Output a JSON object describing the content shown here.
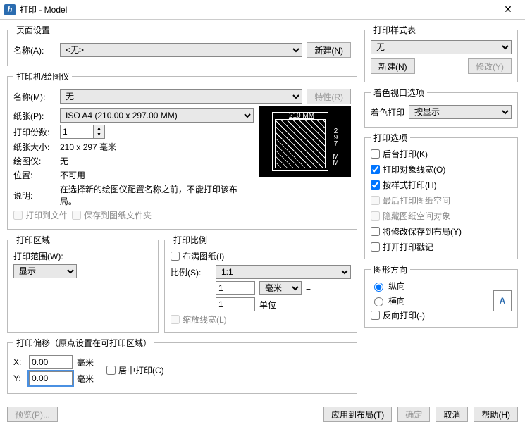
{
  "window": {
    "title": "打印 - Model",
    "app_icon": "h"
  },
  "page_setup": {
    "legend": "页面设置",
    "name_label": "名称(A):",
    "name_value": "<无>",
    "new_btn": "新建(N)"
  },
  "printer": {
    "legend": "打印机/绘图仪",
    "name_label": "名称(M):",
    "name_value": "无",
    "props_btn": "特性(R)",
    "paper_label": "纸张(P):",
    "paper_value": "ISO A4 (210.00 x 297.00 MM)",
    "copies_label": "打印份数:",
    "copies_value": "1",
    "size_label": "纸张大小:",
    "size_value": "210 x 297  毫米",
    "plotter_label": "绘图仪:",
    "plotter_value": "无",
    "location_label": "位置:",
    "location_value": "不可用",
    "desc_label": "说明:",
    "desc_value": "在选择新的绘图仪配置名称之前，不能打印该布局。",
    "to_file": "打印到文件",
    "save_sheet": "保存到图纸文件夹",
    "preview_w": "210 MM",
    "preview_h": "297 MM"
  },
  "area": {
    "legend": "打印区域",
    "range_label": "打印范围(W):",
    "range_value": "显示"
  },
  "scale": {
    "legend": "打印比例",
    "fit": "布满图纸(I)",
    "ratio_label": "比例(S):",
    "ratio_value": "1:1",
    "num": "1",
    "unit_select": "毫米",
    "eq": "=",
    "den": "1",
    "unit_label": "单位",
    "scale_lw": "缩放线宽(L)"
  },
  "offset": {
    "legend": "打印偏移（原点设置在可打印区域）",
    "x_label": "X:",
    "x_value": "0.00",
    "mm": "毫米",
    "y_label": "Y:",
    "y_value": "0.00",
    "center": "居中打印(C)"
  },
  "style": {
    "legend": "打印样式表",
    "value": "无",
    "new_btn": "新建(N)",
    "edit_btn": "修改(Y)"
  },
  "viewport": {
    "legend": "着色视口选项",
    "label": "着色打印",
    "value": "按显示"
  },
  "options": {
    "legend": "打印选项",
    "bg": "后台打印(K)",
    "lw": "打印对象线宽(O)",
    "style": "按样式打印(H)",
    "last": "最后打印图纸空间",
    "hide": "隐藏图纸空间对象",
    "save": "将修改保存到布局(Y)",
    "stamp": "打开打印戳记"
  },
  "orientation": {
    "legend": "图形方向",
    "portrait": "纵向",
    "landscape": "横向",
    "reverse": "反向打印(-)",
    "icon": "A"
  },
  "buttons": {
    "preview": "预览(P)...",
    "apply": "应用到布局(T)",
    "ok": "确定",
    "cancel": "取消",
    "help": "帮助(H)"
  }
}
